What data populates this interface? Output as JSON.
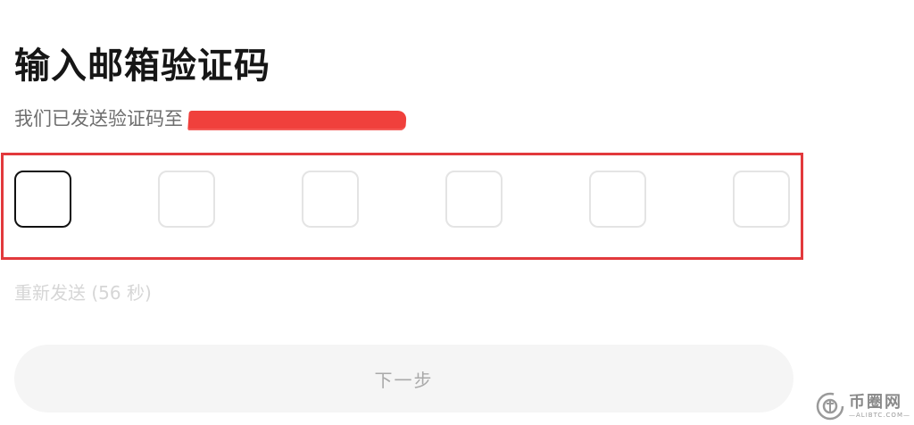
{
  "header": {
    "title": "输入邮箱验证码",
    "subtitle": "我们已发送验证码至"
  },
  "code": {
    "length": 6,
    "active_index": 0,
    "frame_color": "#e2393c"
  },
  "resend": {
    "label": "重新发送 (56 秒)"
  },
  "next_button": {
    "label": "下一步"
  },
  "watermark": {
    "name": "币圈网",
    "url": "—ALIBTC.COM—",
    "icon": "coin-logo-icon"
  },
  "colors": {
    "redaction": "#f0403c",
    "active_box_border": "#111111",
    "inactive_box_border": "#e4e4e4"
  }
}
